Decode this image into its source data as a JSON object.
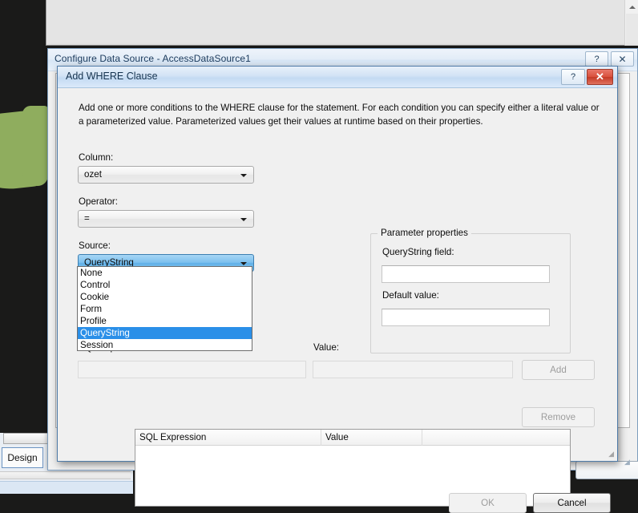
{
  "desktop": {
    "design_tab_label": "Design"
  },
  "outer_dialog": {
    "title": "Configure Data Source - AccessDataSource1",
    "help_glyph": "?",
    "close_glyph": "✕"
  },
  "where_dialog": {
    "title": "Add WHERE Clause",
    "help_glyph": "?",
    "close_glyph": "✕",
    "description": "Add one or more conditions to the WHERE clause for the statement. For each condition you can specify either a literal value or a parameterized value. Parameterized values get their values at runtime based on their properties.",
    "column": {
      "label": "Column:",
      "value": "ozet"
    },
    "operator": {
      "label": "Operator:",
      "value": "="
    },
    "source": {
      "label": "Source:",
      "value": "QueryString",
      "expanded": true,
      "options": [
        "None",
        "Control",
        "Cookie",
        "Form",
        "Profile",
        "QueryString",
        "Session"
      ],
      "selected_option": "QueryString"
    },
    "parameter_properties": {
      "group_title": "Parameter properties",
      "querystring_field_label": "QueryString field:",
      "querystring_field_value": "",
      "default_value_label": "Default value:",
      "default_value_value": ""
    },
    "sql_expression": {
      "label": "SQL Expression:",
      "value": ""
    },
    "value_field": {
      "label": "Value:",
      "value": ""
    },
    "add_button": "Add",
    "remove_button": "Remove",
    "clause_list": {
      "columns": [
        "SQL Expression",
        "Value",
        ""
      ],
      "rows": []
    },
    "ok_button": "OK",
    "cancel_button": "Cancel"
  },
  "colors": {
    "selection_blue": "#2a8fe8",
    "close_red": "#d9503c",
    "title_blue": "#15334f",
    "dialog_bg": "#f0f0f0"
  }
}
